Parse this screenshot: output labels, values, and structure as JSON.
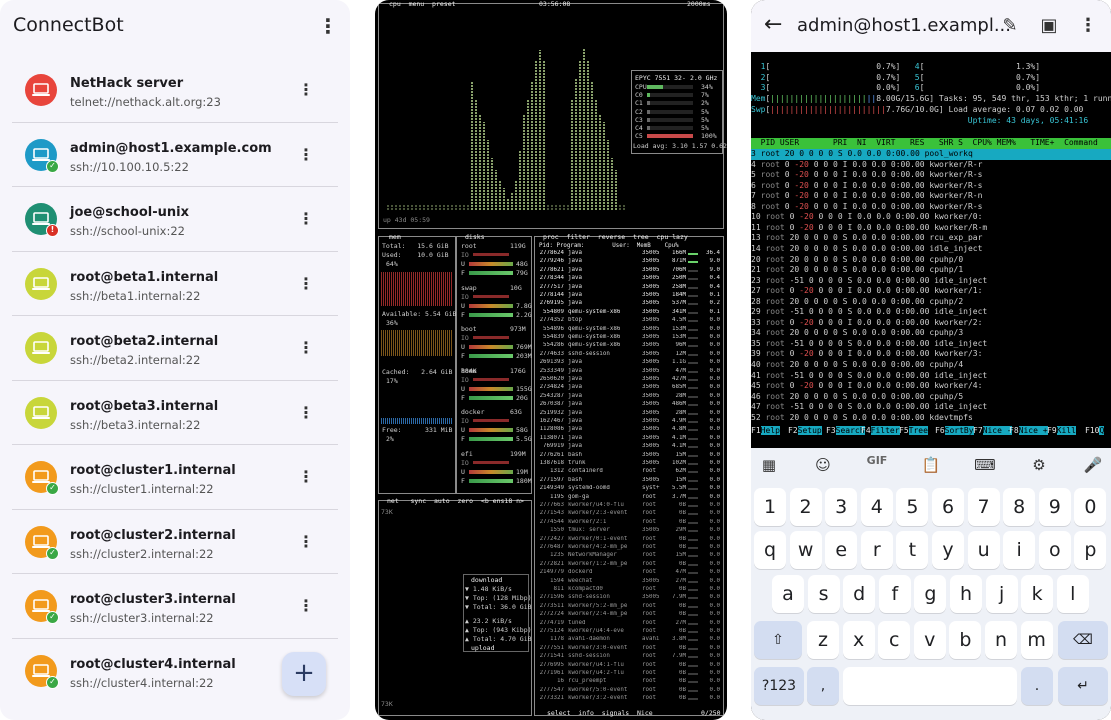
{
  "connectbot": {
    "title": "ConnectBot",
    "menu_icon": "more-vertical-icon",
    "fab_label": "+",
    "hosts": [
      {
        "name": "NetHack server",
        "address": "telnet://nethack.alt.org:23",
        "color": "#e8453c",
        "status": ""
      },
      {
        "name": "admin@host1.example.com",
        "address": "ssh://10.100.10.5:22",
        "color": "#1e9ac7",
        "status": "ok"
      },
      {
        "name": "joe@school-unix",
        "address": "ssh://school-unix:22",
        "color": "#1f8f73",
        "status": "err"
      },
      {
        "name": "root@beta1.internal",
        "address": "ssh://beta1.internal:22",
        "color": "#c8d63a",
        "status": ""
      },
      {
        "name": "root@beta2.internal",
        "address": "ssh://beta2.internal:22",
        "color": "#c8d63a",
        "status": ""
      },
      {
        "name": "root@beta3.internal",
        "address": "ssh://beta3.internal:22",
        "color": "#c8d63a",
        "status": ""
      },
      {
        "name": "root@cluster1.internal",
        "address": "ssh://cluster1.internal:22",
        "color": "#f29a1c",
        "status": "ok"
      },
      {
        "name": "root@cluster2.internal",
        "address": "ssh://cluster2.internal:22",
        "color": "#f29a1c",
        "status": "ok"
      },
      {
        "name": "root@cluster3.internal",
        "address": "ssh://cluster3.internal:22",
        "color": "#f29a1c",
        "status": "ok"
      },
      {
        "name": "root@cluster4.internal",
        "address": "ssh://cluster4.internal:22",
        "color": "#f29a1c",
        "status": "ok"
      }
    ]
  },
  "btop": {
    "header_left": "cpu  menu  preset",
    "clock": "03:56:08",
    "interval": "2000ms",
    "cpu_model": "EPYC 7551 32-",
    "cpu_freq": "2.0 GHz",
    "cpu_rows": [
      {
        "label": "CPU",
        "pct": "34%"
      },
      {
        "label": "C0",
        "pct": "7%"
      },
      {
        "label": "C1",
        "pct": "2%"
      },
      {
        "label": "C2",
        "pct": "5%"
      },
      {
        "label": "C3",
        "pct": "5%"
      },
      {
        "label": "C4",
        "pct": "5%"
      },
      {
        "label": "C5",
        "pct": "100%"
      }
    ],
    "load_avg": "Load avg: 3.10 1.57 0.62",
    "uptime": "up 43d 05:59",
    "mem": {
      "label": "mem",
      "total": "Total:   15.6 GiB",
      "used": "Used:    10.0 GiB",
      "used_pct": "64%",
      "available": "Available: 5.54 GiB",
      "available_pct": "36%",
      "cached": "Cached:   2.64 GiB",
      "cached_pct": "17%",
      "free": "Free:      331 MiB",
      "free_pct": "2%"
    },
    "disks": {
      "label": "disks",
      "items": [
        {
          "name": "root",
          "size": "119G",
          "u": "48G",
          "f": "79G"
        },
        {
          "name": "swap",
          "size": "10G",
          "u": "7.8G",
          "f": "2.2G"
        },
        {
          "name": "boot",
          "size": "973M",
          "u": "769M",
          "f": "203M"
        },
        {
          "name": "home",
          "size": "176G",
          "u": "155G",
          "f": "20G"
        },
        {
          "name": "docker",
          "size": "63G",
          "u": "58G",
          "f": "5.5G"
        },
        {
          "name": "efi",
          "size": "199M",
          "u": "19M",
          "f": "180M"
        }
      ],
      "home_io": "884K"
    },
    "proc_header": "proc  filter  reverse  tree  cpu lazy",
    "proc_cols": "Pid: Program:        User:  MemB    Cpu%",
    "procs": [
      [
        "2778624",
        "java",
        "35005",
        "166M",
        "36.4"
      ],
      [
        "2779246",
        "java",
        "35005",
        "871M",
        "9.0"
      ],
      [
        "2778621",
        "java",
        "35005",
        "706M",
        "9.0"
      ],
      [
        "2778344",
        "java",
        "35005",
        "250M",
        "0.4"
      ],
      [
        "2777517",
        "java",
        "35005",
        "258M",
        "0.4"
      ],
      [
        "2778144",
        "java",
        "35005",
        "184M",
        "0.1"
      ],
      [
        "2769195",
        "java",
        "35005",
        "537M",
        "0.2"
      ],
      [
        "554809",
        "qemu-system-x86",
        "35005",
        "341M",
        "0.1"
      ],
      [
        "2774352",
        "btop",
        "35005",
        "4.5M",
        "0.0"
      ],
      [
        "554896",
        "qemu-system-x86",
        "35005",
        "153M",
        "0.0"
      ],
      [
        "554839",
        "qemu-system-x86",
        "35005",
        "153M",
        "0.0"
      ],
      [
        "554286",
        "qemu-system-x86",
        "35005",
        "96M",
        "0.0"
      ],
      [
        "2774633",
        "sshd-session",
        "35005",
        "12M",
        "0.0"
      ],
      [
        "2691393",
        "java",
        "35005",
        "1.1G",
        "0.0"
      ],
      [
        "2533349",
        "java",
        "35005",
        "47M",
        "0.0"
      ],
      [
        "2650620",
        "java",
        "35005",
        "427M",
        "0.0"
      ],
      [
        "2734824",
        "java",
        "35005",
        "685M",
        "0.0"
      ],
      [
        "2543287",
        "java",
        "35005",
        "28M",
        "0.0"
      ],
      [
        "2670387",
        "java",
        "35005",
        "486M",
        "0.0"
      ],
      [
        "2519932",
        "java",
        "35005",
        "28M",
        "0.0"
      ],
      [
        "1627467",
        "java",
        "35005",
        "4.9M",
        "0.0"
      ],
      [
        "1128086",
        "java",
        "35005",
        "4.8M",
        "0.0"
      ],
      [
        "1138071",
        "java",
        "35005",
        "4.1M",
        "0.0"
      ],
      [
        "769919",
        "java",
        "35005",
        "4.1M",
        "0.0"
      ],
      [
        "2776261",
        "bash",
        "35005",
        "15M",
        "0.0"
      ],
      [
        "1387618",
        "trunk",
        "35005",
        "102M",
        "0.0"
      ],
      [
        "1312",
        "containerd",
        "root",
        "62M",
        "0.0"
      ],
      [
        "2771597",
        "bash",
        "35005",
        "15M",
        "0.0"
      ],
      [
        "2149349",
        "systemd-oomd",
        "syst+",
        "5.5M",
        "0.0"
      ],
      [
        "1195",
        "gom-ga",
        "root",
        "3.7M",
        "0.0"
      ],
      [
        "2777663",
        "kworker/u4:0-flu",
        "root",
        "0B",
        "0.0"
      ],
      [
        "2771543",
        "kworker/2:3-event",
        "root",
        "0B",
        "0.0"
      ],
      [
        "2774544",
        "kworker/2:1",
        "root",
        "0B",
        "0.0"
      ],
      [
        "1550",
        "tmux: server",
        "35005",
        "29M",
        "0.0"
      ],
      [
        "2772427",
        "kworker/0:1-event",
        "root",
        "0B",
        "0.0"
      ],
      [
        "2776487",
        "kworker/4:2-mm_pe",
        "root",
        "0B",
        "0.0"
      ],
      [
        "1235",
        "NetworkManager",
        "root",
        "15M",
        "0.0"
      ],
      [
        "2772821",
        "kworker/1:2-mm_pe",
        "root",
        "0B",
        "0.0"
      ],
      [
        "2149779",
        "dockerd",
        "root",
        "47M",
        "0.0"
      ],
      [
        "1594",
        "weechat",
        "35005",
        "27M",
        "0.0"
      ],
      [
        "811",
        "kcompactd0",
        "root",
        "0B",
        "0.0"
      ],
      [
        "2771596",
        "sshd-session",
        "35005",
        "7.9M",
        "0.0"
      ],
      [
        "2773511",
        "kworker/5:2-mm_pe",
        "root",
        "0B",
        "0.0"
      ],
      [
        "2772724",
        "kworker/2:4-mm_pe",
        "root",
        "0B",
        "0.0"
      ],
      [
        "2774719",
        "tuned",
        "root",
        "27M",
        "0.0"
      ],
      [
        "2775124",
        "kworker/u4:4-eve",
        "root",
        "0B",
        "0.0"
      ],
      [
        "1178",
        "avahi-daemon",
        "avahi",
        "3.8M",
        "0.0"
      ],
      [
        "2777551",
        "kworker/3:0-event",
        "root",
        "0B",
        "0.0"
      ],
      [
        "2771541",
        "sshd-session",
        "root",
        "7.9M",
        "0.0"
      ],
      [
        "2776995",
        "kworker/u4:1-flu",
        "root",
        "0B",
        "0.0"
      ],
      [
        "2771961",
        "kworker/u4:2-flu",
        "root",
        "0B",
        "0.0"
      ],
      [
        "16",
        "rcu_preempt",
        "root",
        "0B",
        "0.0"
      ],
      [
        "2777547",
        "kworker/5:0-event",
        "root",
        "0B",
        "0.0"
      ],
      [
        "2773321",
        "kworker/3:2-event",
        "root",
        "0B",
        "0.0"
      ]
    ],
    "proc_footer": "select  info  signals  Nice",
    "proc_count": "0/250",
    "net": {
      "header": "net   sync  auto  zero  <b ens18 n>",
      "scale_top": "73K",
      "scale_bottom": "73K",
      "download": "download",
      "dl_rate": "1.48 KiB/s",
      "dl_top": "Top: (128 Mibp)",
      "dl_total": "Total: 36.0 GiB",
      "ul_rate": "23.2 KiB/s",
      "ul_top": "Top: (943 Kibp)",
      "ul_total": "Total: 4.70 GiB",
      "upload": "upload"
    }
  },
  "htop_app": {
    "title": "admin@host1.exampl...",
    "back_icon": "arrow-left-icon",
    "edit_icon": "pencil-icon",
    "paste_icon": "clipboard-icon",
    "menu_icon": "more-vertical-icon",
    "meters": [
      {
        "label": "1",
        "pct": "0.7%",
        "label2": "4",
        "pct2": "1.3%"
      },
      {
        "label": "2",
        "pct": "0.7%",
        "label2": "5",
        "pct2": "0.7%"
      },
      {
        "label": "3",
        "pct": "0.0%",
        "label2": "6",
        "pct2": "0.0%"
      }
    ],
    "mem_value": "8.00G/15.6G",
    "swp_value": "7.76G/10.0G",
    "tasks": "Tasks: 95, 549 thr, 153 kthr; 1 runn",
    "load_average": "Load average: 0.07 0.02 0.00",
    "uptime": "Uptime: 43 days, 05:41:16",
    "header_cols": "  PID USER       PRI  NI  VIRT   RES   SHR S  CPU% MEM%   TIME+  Command",
    "procs": [
      [
        "3",
        "root",
        "20",
        "0",
        "0",
        "0",
        "0",
        "S",
        "0.0",
        "0.0",
        "0:00.00",
        "pool_workq"
      ],
      [
        "4",
        "root",
        "0",
        "-20",
        "0",
        "0",
        "0",
        "I",
        "0.0",
        "0.0",
        "0:00.00",
        "kworker/R-r"
      ],
      [
        "5",
        "root",
        "0",
        "-20",
        "0",
        "0",
        "0",
        "I",
        "0.0",
        "0.0",
        "0:00.00",
        "kworker/R-s"
      ],
      [
        "6",
        "root",
        "0",
        "-20",
        "0",
        "0",
        "0",
        "I",
        "0.0",
        "0.0",
        "0:00.00",
        "kworker/R-s"
      ],
      [
        "7",
        "root",
        "0",
        "-20",
        "0",
        "0",
        "0",
        "I",
        "0.0",
        "0.0",
        "0:00.00",
        "kworker/R-n"
      ],
      [
        "8",
        "root",
        "0",
        "-20",
        "0",
        "0",
        "0",
        "I",
        "0.0",
        "0.0",
        "0:00.00",
        "kworker/R-s"
      ],
      [
        "10",
        "root",
        "0",
        "-20",
        "0",
        "0",
        "0",
        "I",
        "0.0",
        "0.0",
        "0:00.00",
        "kworker/0:"
      ],
      [
        "11",
        "root",
        "0",
        "-20",
        "0",
        "0",
        "0",
        "I",
        "0.0",
        "0.0",
        "0:00.00",
        "kworker/R-m"
      ],
      [
        "13",
        "root",
        "20",
        "0",
        "0",
        "0",
        "0",
        "S",
        "0.0",
        "0.0",
        "0:00.00",
        "rcu_exp_par"
      ],
      [
        "14",
        "root",
        "20",
        "0",
        "0",
        "0",
        "0",
        "S",
        "0.0",
        "0.0",
        "0:00.00",
        "idle_inject"
      ],
      [
        "20",
        "root",
        "20",
        "0",
        "0",
        "0",
        "0",
        "S",
        "0.0",
        "0.0",
        "0:00.00",
        "cpuhp/0"
      ],
      [
        "21",
        "root",
        "20",
        "0",
        "0",
        "0",
        "0",
        "S",
        "0.0",
        "0.0",
        "0:00.00",
        "cpuhp/1"
      ],
      [
        "23",
        "root",
        "-51",
        "0",
        "0",
        "0",
        "0",
        "S",
        "0.0",
        "0.0",
        "0:00.00",
        "idle_inject"
      ],
      [
        "27",
        "root",
        "0",
        "-20",
        "0",
        "0",
        "0",
        "I",
        "0.0",
        "0.0",
        "0:00.00",
        "kworker/1:"
      ],
      [
        "28",
        "root",
        "20",
        "0",
        "0",
        "0",
        "0",
        "S",
        "0.0",
        "0.0",
        "0:00.00",
        "cpuhp/2"
      ],
      [
        "29",
        "root",
        "-51",
        "0",
        "0",
        "0",
        "0",
        "S",
        "0.0",
        "0.0",
        "0:00.00",
        "idle_inject"
      ],
      [
        "33",
        "root",
        "0",
        "-20",
        "0",
        "0",
        "0",
        "I",
        "0.0",
        "0.0",
        "0:00.00",
        "kworker/2:"
      ],
      [
        "34",
        "root",
        "20",
        "0",
        "0",
        "0",
        "0",
        "S",
        "0.0",
        "0.0",
        "0:00.00",
        "cpuhp/3"
      ],
      [
        "35",
        "root",
        "-51",
        "0",
        "0",
        "0",
        "0",
        "S",
        "0.0",
        "0.0",
        "0:00.00",
        "idle_inject"
      ],
      [
        "39",
        "root",
        "0",
        "-20",
        "0",
        "0",
        "0",
        "I",
        "0.0",
        "0.0",
        "0:00.00",
        "kworker/3:"
      ],
      [
        "40",
        "root",
        "20",
        "0",
        "0",
        "0",
        "0",
        "S",
        "0.0",
        "0.0",
        "0:00.00",
        "cpuhp/4"
      ],
      [
        "41",
        "root",
        "-51",
        "0",
        "0",
        "0",
        "0",
        "S",
        "0.0",
        "0.0",
        "0:00.00",
        "idle_inject"
      ],
      [
        "45",
        "root",
        "0",
        "-20",
        "0",
        "0",
        "0",
        "I",
        "0.0",
        "0.0",
        "0:00.00",
        "kworker/4:"
      ],
      [
        "46",
        "root",
        "20",
        "0",
        "0",
        "0",
        "0",
        "S",
        "0.0",
        "0.0",
        "0:00.00",
        "cpuhp/5"
      ],
      [
        "47",
        "root",
        "-51",
        "0",
        "0",
        "0",
        "0",
        "S",
        "0.0",
        "0.0",
        "0:00.00",
        "idle_inject"
      ],
      [
        "52",
        "root",
        "20",
        "0",
        "0",
        "0",
        "0",
        "S",
        "0.0",
        "0.0",
        "0:00.00",
        "kdevtmpfs"
      ]
    ],
    "fkeys": [
      {
        "num": "F1",
        "label": "Help"
      },
      {
        "num": "F2",
        "label": "Setup"
      },
      {
        "num": "F3",
        "label": "Search"
      },
      {
        "num": "F4",
        "label": "Filter"
      },
      {
        "num": "F5",
        "label": "Tree"
      },
      {
        "num": "F6",
        "label": "SortBy"
      },
      {
        "num": "F7",
        "label": "Nice -"
      },
      {
        "num": "F8",
        "label": "Nice +"
      },
      {
        "num": "F9",
        "label": "Kill"
      },
      {
        "num": "F10",
        "label": "Q"
      }
    ]
  },
  "keyboard": {
    "toolbar": [
      {
        "name": "apps-grid-icon",
        "glyph": "▦"
      },
      {
        "name": "sticker-icon",
        "glyph": "☺"
      },
      {
        "name": "gif-icon",
        "glyph": "GIF"
      },
      {
        "name": "clipboard-icon",
        "glyph": "📋"
      },
      {
        "name": "keyboard-icon",
        "glyph": "⌨"
      },
      {
        "name": "settings-icon",
        "glyph": "⚙"
      },
      {
        "name": "microphone-icon",
        "glyph": "🎤"
      }
    ],
    "row1": [
      "1",
      "2",
      "3",
      "4",
      "5",
      "6",
      "7",
      "8",
      "9",
      "0"
    ],
    "row2": [
      "q",
      "w",
      "e",
      "r",
      "t",
      "y",
      "u",
      "i",
      "o",
      "p"
    ],
    "row3": [
      "a",
      "s",
      "d",
      "f",
      "g",
      "h",
      "j",
      "k",
      "l"
    ],
    "row4": [
      "z",
      "x",
      "c",
      "v",
      "b",
      "n",
      "m"
    ],
    "shift": "⇧",
    "backspace": "⌫",
    "symbols": "?123",
    "comma": ",",
    "period": ".",
    "enter": "↵"
  }
}
